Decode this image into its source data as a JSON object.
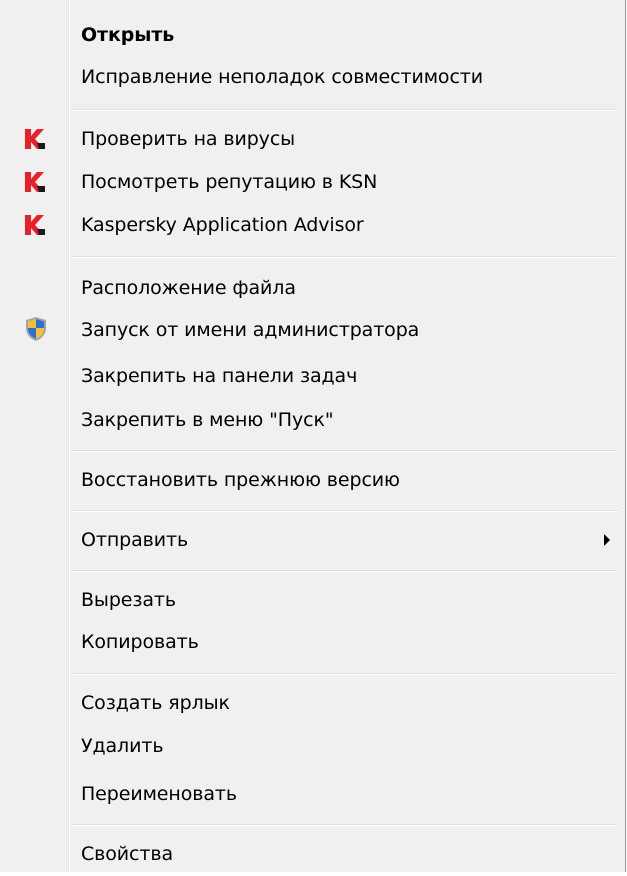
{
  "menu": {
    "items": [
      {
        "label": "Открыть",
        "bold": true,
        "icon": null
      },
      {
        "label": "Исправление неполадок совместимости",
        "icon": null
      },
      {
        "label": "Проверить на вирусы",
        "icon": "kaspersky-icon"
      },
      {
        "label": "Посмотреть репутацию в KSN",
        "icon": "kaspersky-icon"
      },
      {
        "label": "Kaspersky Application Advisor",
        "icon": "kaspersky-icon"
      },
      {
        "label": "Расположение файла",
        "icon": null
      },
      {
        "label": "Запуск от имени администратора",
        "icon": "uac-shield-icon"
      },
      {
        "label": "Закрепить на панели задач",
        "icon": null
      },
      {
        "label": "Закрепить в меню \"Пуск\"",
        "icon": null
      },
      {
        "label": "Восстановить прежнюю версию",
        "icon": null
      },
      {
        "label": "Отправить",
        "icon": null,
        "submenu": true
      },
      {
        "label": "Вырезать",
        "icon": null
      },
      {
        "label": "Копировать",
        "icon": null
      },
      {
        "label": "Создать ярлык",
        "icon": null
      },
      {
        "label": "Удалить",
        "icon": null
      },
      {
        "label": "Переименовать",
        "icon": null
      },
      {
        "label": "Свойства",
        "icon": null
      }
    ]
  },
  "colors": {
    "menu_background": "#f0f0f0",
    "kaspersky_red": "#e8202a",
    "uac_blue": "#2f6fd6",
    "uac_yellow": "#f2c230"
  }
}
